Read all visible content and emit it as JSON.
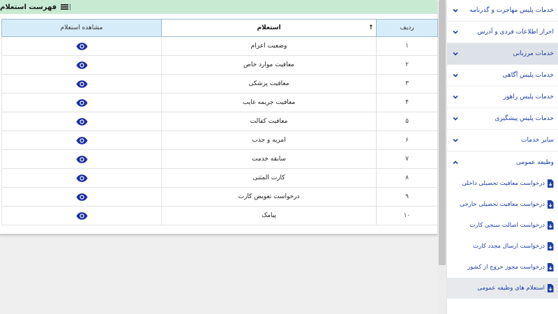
{
  "panel": {
    "title": "فهرست استعلام",
    "columns": {
      "index": "ردیف",
      "query": "استعلام",
      "view": "مشاهده استعلام"
    },
    "rows": [
      {
        "idx": "۱",
        "name": "وضعیت اعزام"
      },
      {
        "idx": "۲",
        "name": "معافیت موارد خاص"
      },
      {
        "idx": "۳",
        "name": "معافیت پزشکی"
      },
      {
        "idx": "۴",
        "name": "معافیت جریمه غایب"
      },
      {
        "idx": "۵",
        "name": "معافیت کفالت"
      },
      {
        "idx": "۶",
        "name": "امریه و جذب"
      },
      {
        "idx": "۷",
        "name": "سابقه خدمت"
      },
      {
        "idx": "۸",
        "name": "کارت المثنی"
      },
      {
        "idx": "۹",
        "name": "درخواست تعویض کارت"
      },
      {
        "idx": "۱۰",
        "name": "پیامک"
      }
    ]
  },
  "sidebar": {
    "items": [
      {
        "label": "خدمات پلیس مهاجرت و گذرنامه"
      },
      {
        "label": "احراز اطلاعات فردی و آدرس"
      },
      {
        "label": "خدمات مرزبانی"
      },
      {
        "label": "خدمات پلیس آگاهی"
      },
      {
        "label": "خدمات پلیس راهور"
      },
      {
        "label": "خدمات پلیس پیشگیری"
      },
      {
        "label": "سایر خدمات"
      },
      {
        "label": "وظیفه عمومی"
      }
    ],
    "subitems": [
      {
        "label": "درخواست معافیت تحصیلی داخلی"
      },
      {
        "label": "درخواست معافیت تحصیلی خارجی"
      },
      {
        "label": "درخواست اصالت سنجی کارت"
      },
      {
        "label": "درخواست ارسال مجدد کارت"
      },
      {
        "label": "درخواست مجوز خروج از کشور"
      },
      {
        "label": "استعلام های وظیفه عمومی"
      }
    ]
  },
  "colors": {
    "header_bar": "#c9ead2",
    "table_header": "#d7ecf9",
    "link": "#1f3fa8",
    "eye_icon": "#1b2fa3"
  }
}
